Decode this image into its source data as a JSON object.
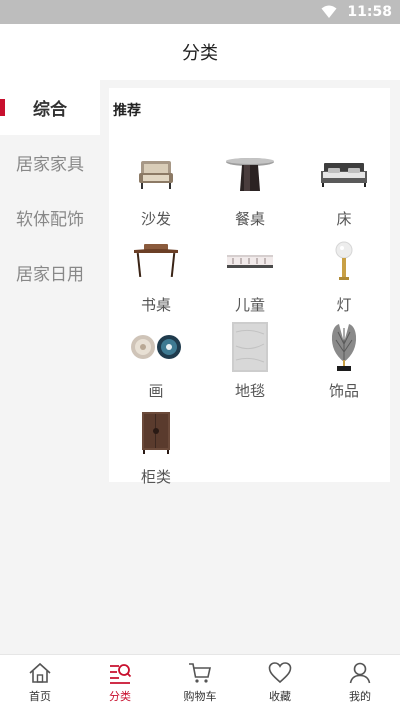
{
  "status": {
    "time": "11:58"
  },
  "header": {
    "title": "分类"
  },
  "sidebar": {
    "items": [
      {
        "label": "综合"
      },
      {
        "label": "居家家具"
      },
      {
        "label": "软体配饰"
      },
      {
        "label": "居家日用"
      }
    ]
  },
  "section": {
    "title": "推荐"
  },
  "categories": [
    {
      "label": "沙发",
      "icon": "sofa-icon"
    },
    {
      "label": "餐桌",
      "icon": "dining-table-icon"
    },
    {
      "label": "床",
      "icon": "bed-icon"
    },
    {
      "label": "书桌",
      "icon": "desk-icon"
    },
    {
      "label": "儿童",
      "icon": "kids-bed-icon"
    },
    {
      "label": "灯",
      "icon": "lamp-icon"
    },
    {
      "label": "画",
      "icon": "painting-icon"
    },
    {
      "label": "地毯",
      "icon": "rug-icon"
    },
    {
      "label": "饰品",
      "icon": "ornament-icon"
    },
    {
      "label": "柜类",
      "icon": "cabinet-icon"
    }
  ],
  "tabs": [
    {
      "label": "首页",
      "icon": "home-icon"
    },
    {
      "label": "分类",
      "icon": "category-icon"
    },
    {
      "label": "购物车",
      "icon": "cart-icon"
    },
    {
      "label": "收藏",
      "icon": "heart-icon"
    },
    {
      "label": "我的",
      "icon": "user-icon"
    }
  ],
  "colors": {
    "accent": "#c8102e",
    "status_bar": "#bdbdbd",
    "sidebar_bg": "#f4f4f4"
  }
}
